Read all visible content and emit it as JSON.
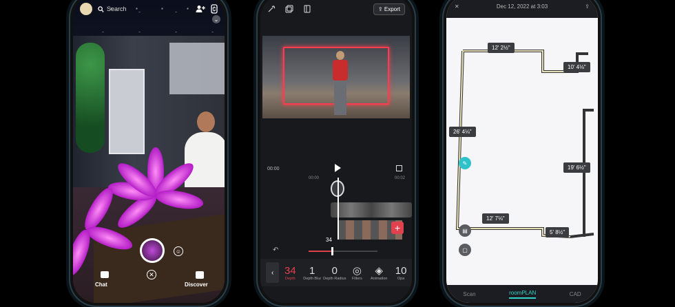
{
  "phone1": {
    "search_placeholder": "Search",
    "nav": {
      "chat": "Chat",
      "discover": "Discover"
    },
    "icons": [
      "avatar",
      "search-icon",
      "add-friend-icon",
      "flip-camera-icon",
      "chevron-down-icon",
      "smile-icon",
      "close-icon",
      "chat-icon",
      "discover-icon"
    ]
  },
  "phone2": {
    "export_label": "Export",
    "time_current": "00:00",
    "ruler_ticks": [
      "00:00",
      "00:02"
    ],
    "frame_number": "34",
    "tools": [
      {
        "value": "34",
        "name": "Depth"
      },
      {
        "value": "1",
        "name": "Depth Blur"
      },
      {
        "value": "0",
        "name": "Depth Radius"
      },
      {
        "value": "",
        "name": "Filters"
      },
      {
        "value": "",
        "name": "Animation"
      },
      {
        "value": "10",
        "name": "Opa"
      }
    ],
    "slider_fraction": 0.33,
    "accent": "#e0414f"
  },
  "phone3": {
    "title": "Dec 12, 2022 at 3:03",
    "dimensions": [
      "12' 2½\"",
      "10' 4⅛\"",
      "26' 4⅛\"",
      "19' 6½\"",
      "12' 7⅛\"",
      "5' 8½\""
    ],
    "bottom_tabs": [
      "Scan",
      "roomPLAN",
      "CAD"
    ],
    "active_tab": "roomPLAN",
    "accent": "#2fd3c7"
  }
}
